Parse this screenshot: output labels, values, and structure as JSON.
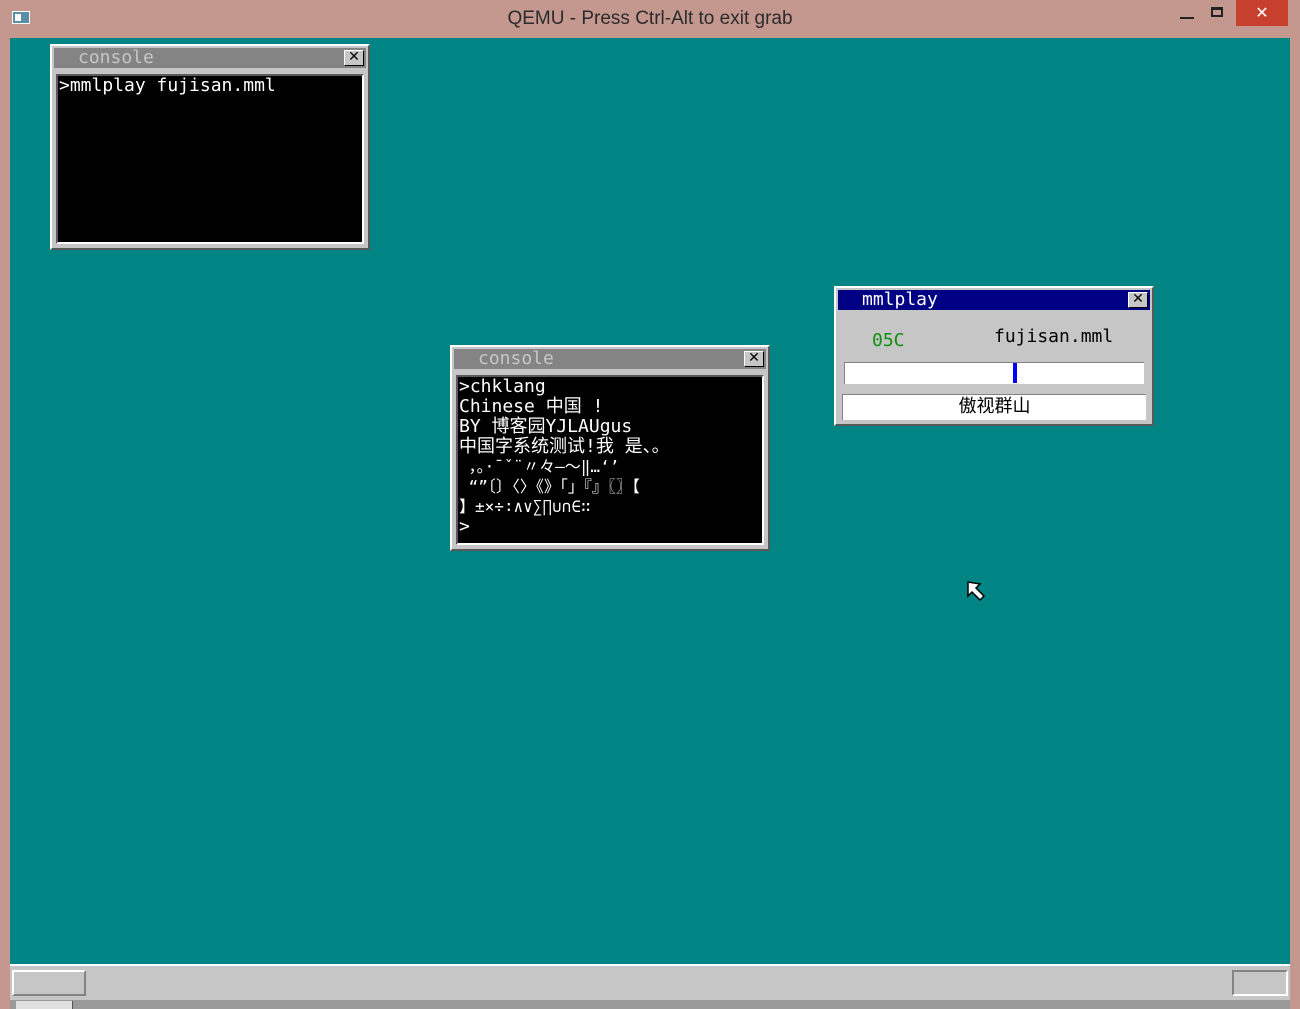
{
  "host_window": {
    "title": "QEMU - Press Ctrl-Alt to exit grab",
    "close_glyph": "✕"
  },
  "console1": {
    "title": "console",
    "close_glyph": "✕",
    "lines": [
      ">mmlplay fujisan.mml"
    ]
  },
  "console2": {
    "title": "console",
    "close_glyph": "✕",
    "lines": [
      ">chklang",
      "Chinese 中国 !",
      "BY 博客园YJLAUgus",
      "中国字系统测试!我 是、。",
      " ，。·ˉˇ¨〃々—～‖…‘’",
      " “”〔〕〈〉《》「」『』〖〗【",
      "】±×÷∶∧∨∑∏∪∩∈∷",
      ">"
    ]
  },
  "mmlplay": {
    "title": "mmlplay",
    "close_glyph": "✕",
    "tempo": "05C",
    "file": "fujisan.mml",
    "progress": 0.56,
    "song_title": "傲视群山"
  },
  "colors": {
    "desktop": "#008484",
    "active_title": "#000084",
    "inactive_title": "#848484",
    "tempo_text": "#109010"
  },
  "icons": {
    "cursor": "arrow-cursor-icon",
    "close": "close-icon"
  }
}
